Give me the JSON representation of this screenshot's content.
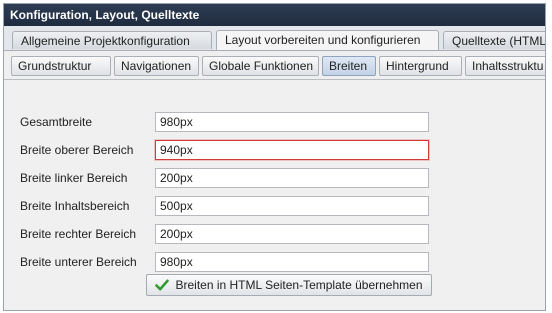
{
  "window": {
    "title": "Konfiguration, Layout, Quelltexte"
  },
  "tabs": [
    {
      "label": "Allgemeine Projektkonfiguration"
    },
    {
      "label": "Layout vorbereiten und konfigurieren",
      "active": true
    },
    {
      "label": "Quelltexte (HTML"
    }
  ],
  "subtabs": [
    {
      "label": "Grundstruktur"
    },
    {
      "label": "Navigationen"
    },
    {
      "label": "Globale Funktionen"
    },
    {
      "label": "Breiten",
      "active": true
    },
    {
      "label": "Hintergrund"
    },
    {
      "label": "Inhaltsstruktu"
    }
  ],
  "fields": [
    {
      "label": "Gesamtbreite",
      "value": "980px"
    },
    {
      "label": "Breite oberer Bereich",
      "value": "940px",
      "focused": true
    },
    {
      "label": "Breite linker Bereich",
      "value": "200px"
    },
    {
      "label": "Breite Inhaltsbereich",
      "value": "500px"
    },
    {
      "label": "Breite rechter Bereich",
      "value": "200px"
    },
    {
      "label": "Breite unterer Bereich",
      "value": "980px"
    }
  ],
  "apply_button": {
    "label": "Breiten in HTML Seiten-Template übernehmen",
    "icon": "checkmark-icon"
  },
  "colors": {
    "titlebar": "#1f2b3e",
    "focus_border": "#d33a3a",
    "check": "#2f9a2f"
  }
}
